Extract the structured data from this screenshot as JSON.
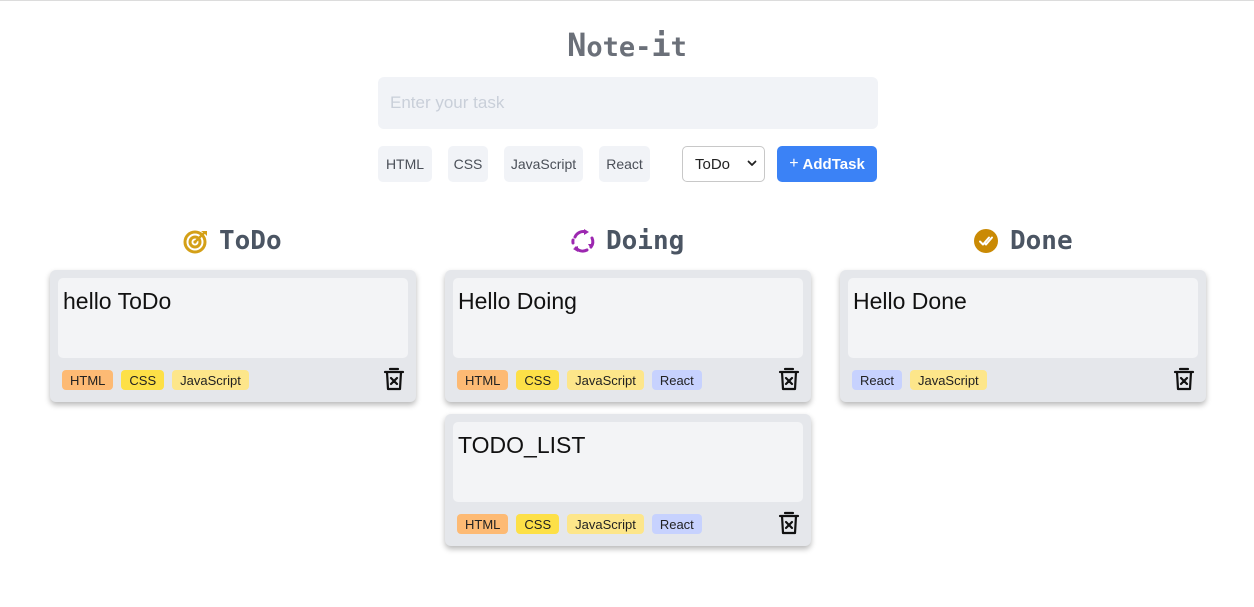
{
  "app": {
    "title_first": "N",
    "title_mid": "ote-",
    "title_i": "i",
    "title_last": "t"
  },
  "form": {
    "input_placeholder": "Enter your task",
    "input_value": "",
    "tags": [
      "HTML",
      "CSS",
      "JavaScript",
      "React"
    ],
    "status_selected": "ToDo",
    "add_icon": "+",
    "add_label": "AddTask"
  },
  "columns": [
    {
      "title": "ToDo",
      "icon": "target-icon",
      "icon_color": "#d4a017",
      "tasks": [
        {
          "text": "hello ToDo",
          "tags": [
            "HTML",
            "CSS",
            "JavaScript"
          ]
        }
      ]
    },
    {
      "title": "Doing",
      "icon": "sync-icon",
      "icon_color": "#9c27b0",
      "tasks": [
        {
          "text": "Hello Doing",
          "tags": [
            "HTML",
            "CSS",
            "JavaScript",
            "React"
          ]
        },
        {
          "text": "TODO_LIST",
          "tags": [
            "HTML",
            "CSS",
            "JavaScript",
            "React"
          ]
        }
      ]
    },
    {
      "title": "Done",
      "icon": "check-circle-icon",
      "icon_color": "#ca8a04",
      "tasks": [
        {
          "text": "Hello Done",
          "tags": [
            "React",
            "JavaScript"
          ]
        }
      ]
    }
  ],
  "colors": {
    "accent": "#3b82f6",
    "tag_html": "#fdba74",
    "tag_css": "#fde047",
    "tag_javascript": "#fde68a",
    "tag_react": "#c7d2fe"
  }
}
